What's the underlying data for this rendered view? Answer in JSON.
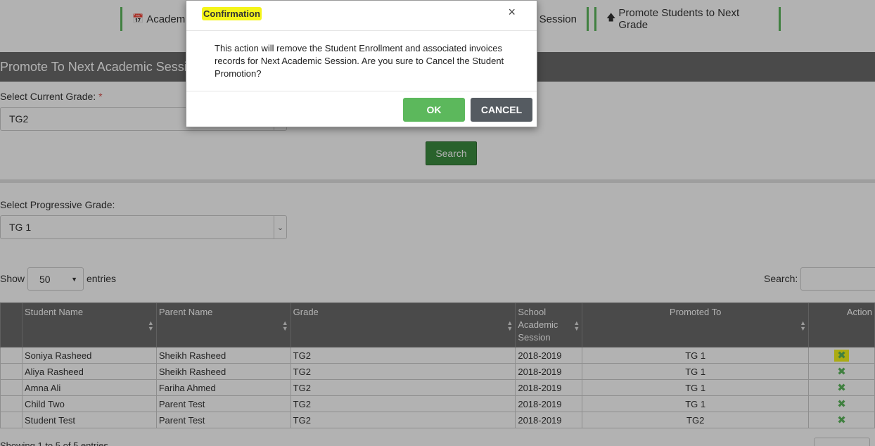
{
  "nav": {
    "tab1": "Academic",
    "tab2": "c Session",
    "tab3": "Promote Students to Next Grade"
  },
  "panel": {
    "title": "Promote To Next Academic Sessi"
  },
  "form": {
    "current_grade_label": "Select Current Grade:",
    "required_mark": "*",
    "current_grade_value": "TG2",
    "search_button": "Search",
    "progressive_grade_label": "Select Progressive Grade:",
    "progressive_grade_value": "TG 1"
  },
  "table_controls": {
    "show_label": "Show",
    "entries_value": "50",
    "entries_label": "entries",
    "search_label": "Search:"
  },
  "table": {
    "headers": [
      "Student Name",
      "Parent Name",
      "Grade",
      "School Academic Session",
      "Promoted To",
      "Action"
    ],
    "rows": [
      [
        "Soniya Rasheed",
        "Sheikh Rasheed",
        "TG2",
        "2018-2019",
        "TG 1"
      ],
      [
        "Aliya Rasheed",
        "Sheikh Rasheed",
        "TG2",
        "2018-2019",
        "TG 1"
      ],
      [
        "Amna Ali",
        "Fariha Ahmed",
        "TG2",
        "2018-2019",
        "TG 1"
      ],
      [
        "Child Two",
        "Parent Test",
        "TG2",
        "2018-2019",
        "TG 1"
      ],
      [
        "Student Test",
        "Parent Test",
        "TG2",
        "2018-2019",
        "TG2"
      ]
    ]
  },
  "footer": {
    "info": "Showing 1 to 5 of 5 entries"
  },
  "modal": {
    "title": "Confirmation",
    "close": "×",
    "message": "This action will remove the Student Enrollment and associated invoices records for Next Academic Session. Are you sure to Cancel the Student Promotion?",
    "ok": "OK",
    "cancel": "CANCEL"
  },
  "colors": {
    "accent_green": "#5cb85c",
    "header_gray": "#6b6b6b",
    "highlight": "#f5f51a"
  }
}
